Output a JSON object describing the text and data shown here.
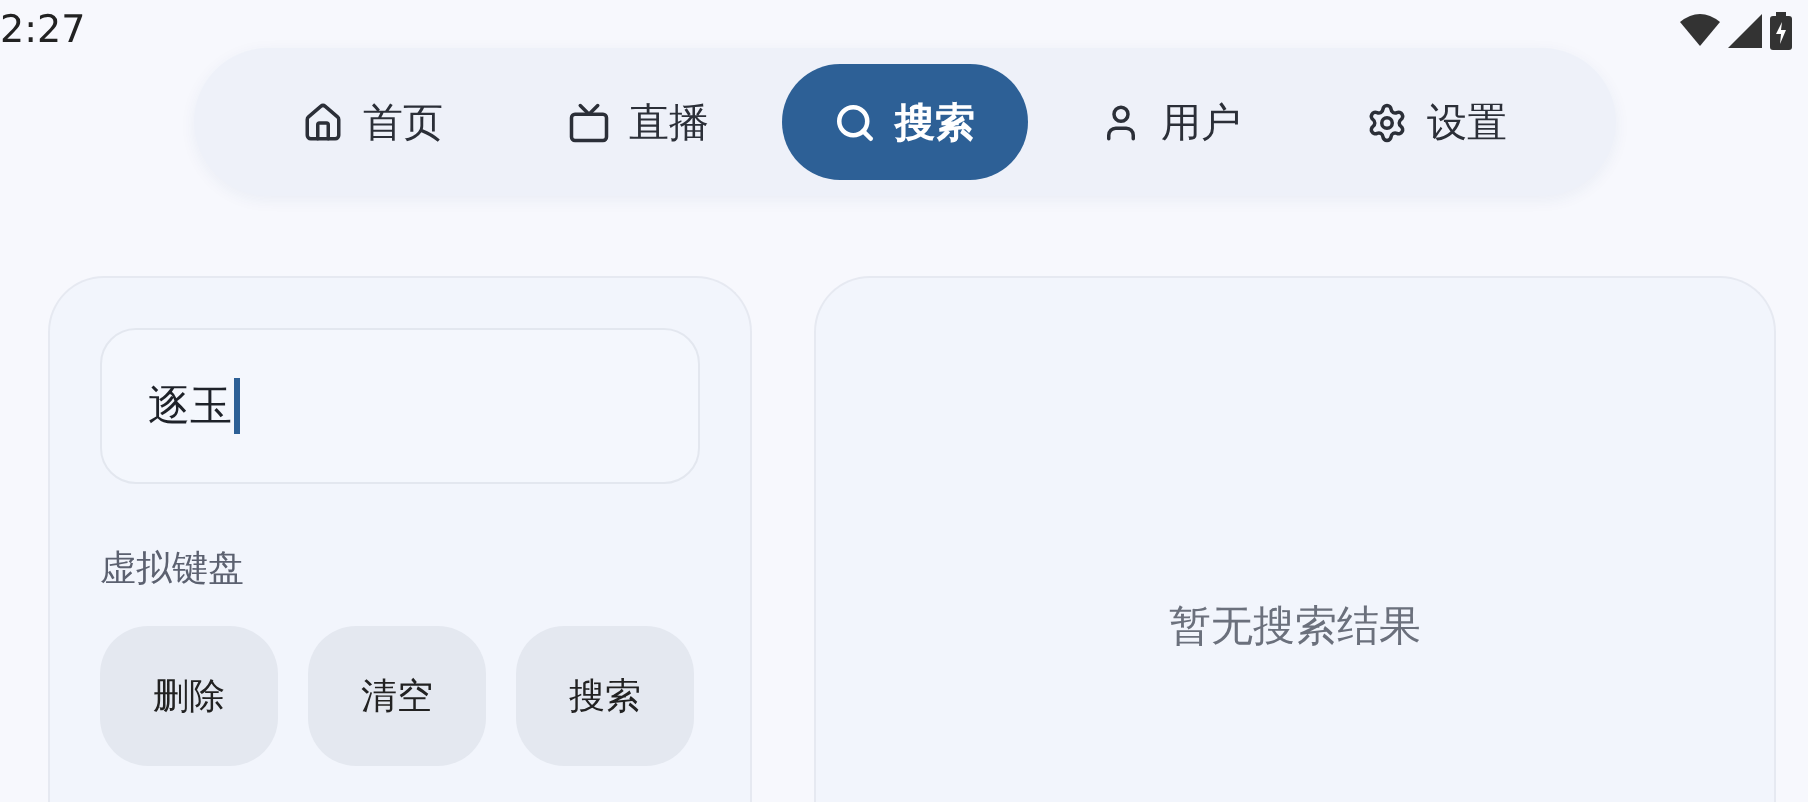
{
  "status_bar": {
    "time": "2:27"
  },
  "nav": [
    {
      "kind": "home",
      "label": "首页",
      "selected": false
    },
    {
      "kind": "live",
      "label": "直播",
      "selected": false
    },
    {
      "kind": "search",
      "label": "搜索",
      "selected": true
    },
    {
      "kind": "user",
      "label": "用户",
      "selected": false
    },
    {
      "kind": "settings",
      "label": "设置",
      "selected": false
    }
  ],
  "search_panel": {
    "value": "逐玉",
    "keyboard_label": "虚拟键盘",
    "keys": [
      "删除",
      "清空",
      "搜索"
    ]
  },
  "results": {
    "empty_message": "暂无搜索结果"
  }
}
